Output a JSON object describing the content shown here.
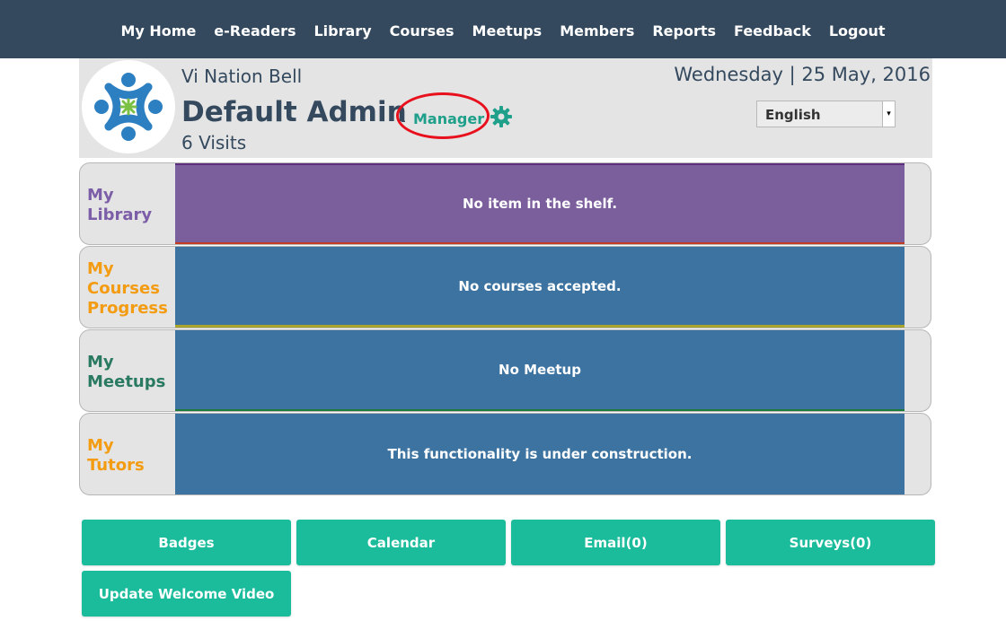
{
  "nav": {
    "items": [
      "My Home",
      "e-Readers",
      "Library",
      "Courses",
      "Meetups",
      "Members",
      "Reports",
      "Feedback",
      "Logout"
    ]
  },
  "header": {
    "school": "Vi Nation Bell",
    "user_name": "Default Admin",
    "role_dash": "-",
    "role": "Manager",
    "visits": "6 Visits",
    "date": "Wednesday | 25 May, 2016",
    "language": "English"
  },
  "panels": [
    {
      "label_line1": "My",
      "label_line2": "Library",
      "label_line3": "",
      "message": "No item in the shelf.",
      "label_color": "#7b5ea7",
      "body_color": "#7b5f9d"
    },
    {
      "label_line1": "My",
      "label_line2": "Courses",
      "label_line3": "Progress",
      "message": "No courses accepted.",
      "label_color": "#f39c12",
      "body_color": "#3d73a0"
    },
    {
      "label_line1": "My",
      "label_line2": "Meetups",
      "label_line3": "",
      "message": "No Meetup",
      "label_color": "#2a7a62",
      "body_color": "#3d73a0"
    },
    {
      "label_line1": "My",
      "label_line2": "Tutors",
      "label_line3": "",
      "message": "This functionality is under construction.",
      "label_color": "#f39c12",
      "body_color": "#3d73a0"
    }
  ],
  "buttons": {
    "badges": "Badges",
    "calendar": "Calendar",
    "email": "Email(0)",
    "surveys": "Surveys(0)",
    "welcome_video": "Update Welcome Video"
  },
  "colors": {
    "nav_bg": "#34495e",
    "accent": "#1abc9c",
    "highlight": "#e8101c"
  }
}
